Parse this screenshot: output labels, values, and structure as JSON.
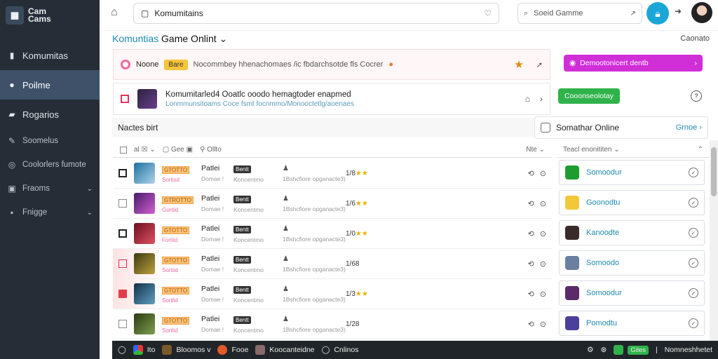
{
  "app": {
    "logo_line1": "Cam",
    "logo_line2": "Cams"
  },
  "sidebar": {
    "items": [
      {
        "label": "Komumitas",
        "icon": "chart-icon"
      },
      {
        "label": "Poilme",
        "icon": "user-icon"
      },
      {
        "label": "Rogarios",
        "icon": "folder-icon"
      },
      {
        "label": "Soomelus",
        "icon": "wrench-icon"
      },
      {
        "label": "Coolorlers fumote",
        "icon": "globe-icon"
      },
      {
        "label": "Fraoms",
        "icon": "grid-icon"
      },
      {
        "label": "Fnigge",
        "icon": "tag-icon"
      }
    ]
  },
  "topbar": {
    "search_value": "Komumitains",
    "game_search_placeholder": "Soeid Gamme"
  },
  "page": {
    "title_part1": "Komuntias",
    "title_part2": "Game Onlint",
    "right_label": "Caonato"
  },
  "banner1": {
    "label": "Noone",
    "badge": "Bare",
    "message": "Nocommbey hhenachomaes /ic fbdarchsotde fls Cocrer"
  },
  "banner2": {
    "line1": "Komumitarled4 Ooatlc ooodo hemagtoder enapmed",
    "line2": "Lonmmunsitoams Coce fsmt focnmmo/Monooctetlg/aoenaes"
  },
  "side_panel": {
    "purple_btn": "Demootonicert dentb",
    "green_btn": "Cooonseolotay"
  },
  "list": {
    "title": "Nactes birt",
    "online_label": "Somathar Online",
    "online_right": "Grnoe"
  },
  "table_head": {
    "col1": "al",
    "col2": "Gee",
    "col3": "Ollto",
    "right": "Nte"
  },
  "side_head": {
    "label": "Teacl enonititen"
  },
  "rows": [
    {
      "tag": "GTOTTO",
      "tag2": "Sortisd",
      "name": "Patlei",
      "sub": "Domae !",
      "pill": "Bentt",
      "c_sub": "Koncentmo",
      "d": "1Bshcfiore",
      "d_sub": "opganacte3)",
      "rating": "1/8",
      "stars": "★★",
      "rating_sub": ""
    },
    {
      "tag": "GTROTTO",
      "tag2": "Gortiid",
      "name": "Patlei",
      "sub": "Domae !",
      "pill": "Bentt",
      "c_sub": "Koncentmo",
      "d": "1Bshcfiore",
      "d_sub": "opganacte3)",
      "rating": "1/6",
      "stars": "★★",
      "rating_sub": ""
    },
    {
      "tag": "GTOTTO",
      "tag2": "Fortlid",
      "name": "Patlei",
      "sub": "Domae !",
      "pill": "Bentt",
      "c_sub": "Koncentmo",
      "d": "1Bshcfiore",
      "d_sub": "opganacte3)",
      "rating": "1/0",
      "stars": "★★",
      "rating_sub": ""
    },
    {
      "tag": "GTOTTO",
      "tag2": "Sortiid",
      "name": "Patlei",
      "sub": "Domae !",
      "pill": "Bentt",
      "c_sub": "Koncentmo",
      "d": "1Bshcfiore",
      "d_sub": "opganacte3)",
      "rating": "1/68",
      "stars": "",
      "rating_sub": ""
    },
    {
      "tag": "GTOTTO",
      "tag2": "Sortlid",
      "name": "Patlei",
      "sub": "Domae !",
      "pill": "Bentt",
      "c_sub": "Koncentmo",
      "d": "1Bshcfiore",
      "d_sub": "opganacte3)",
      "rating": "1/3",
      "stars": "★★",
      "rating_sub": ""
    },
    {
      "tag": "GTOTTO",
      "tag2": "Sortlid",
      "name": "Patlei",
      "sub": "Domae !",
      "pill": "Bentt",
      "c_sub": "Koncentmo",
      "d": "1Bshcfiore",
      "d_sub": "opganacte3)",
      "rating": "1/28",
      "stars": "",
      "rating_sub": ""
    }
  ],
  "side_rows": [
    {
      "name": "Somoodur",
      "color": "#1f9c2f"
    },
    {
      "name": "Goonodtu",
      "color": "#f2c83a"
    },
    {
      "name": "Kanoodte",
      "color": "#3a2a2a"
    },
    {
      "name": "Somoodo",
      "color": "#6b7fa0"
    },
    {
      "name": "Somoodur",
      "color": "#5a2a6a"
    },
    {
      "name": "Pomodtu",
      "color": "#4a3f9a"
    }
  ],
  "taskbar": {
    "item1": "Ito",
    "item2": "Bloomos v",
    "item3": "Fooe",
    "item4": "Koocanteidne",
    "item5": "Cnlinos",
    "item6": "Giles",
    "item7": "Nomneshhetet"
  },
  "colors": {
    "sidebar_bg": "#262d36",
    "accent": "#1aa7d6",
    "purple": "#d02fd8",
    "green": "#2fb24a"
  }
}
